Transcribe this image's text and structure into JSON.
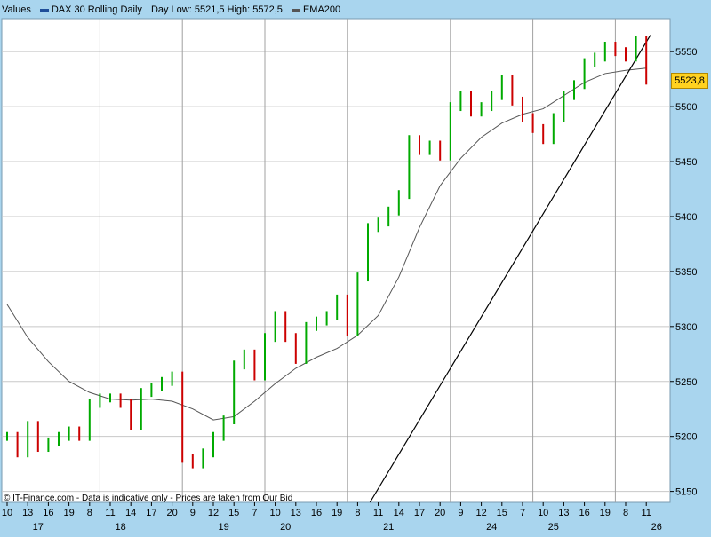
{
  "legend": {
    "label": "Values",
    "instrument": "DAX 30  Rolling Daily",
    "day_range": "Day Low: 5521,5  High: 5572,5",
    "indicator": "EMA200",
    "instrument_color": "#1f4e99",
    "indicator_color": "#555555"
  },
  "footer": {
    "copyright": "© IT-Finance.com  - Data is indicative only - Prices are taken from Our Bid"
  },
  "last_price": "5523,8",
  "colors": {
    "plot_background": "#ffffff",
    "outer_background": "#a9d5ee",
    "up_bar": "#00aa00",
    "down_bar": "#cc0000",
    "ema": "#555555",
    "trendline": "#000000",
    "grid": "#c8c8c8",
    "last_price_box": "#ffd21f"
  },
  "chart_data": {
    "type": "line",
    "instrument": "DAX 30",
    "indicator": "EMA200",
    "ylim": [
      5140,
      5580
    ],
    "y_ticks": [
      5150,
      5200,
      5250,
      5300,
      5350,
      5400,
      5450,
      5500,
      5550
    ],
    "y_tick_labels": [
      "5150",
      "5200",
      "5250",
      "5300",
      "5350",
      "5400",
      "5450",
      "5500",
      "5550"
    ],
    "x_hour_labels": [
      "10",
      "13",
      "16",
      "19",
      "8",
      "11",
      "14",
      "17",
      "20",
      "9",
      "12",
      "15",
      "7",
      "10",
      "13",
      "16",
      "19",
      "8",
      "11",
      "14",
      "17",
      "20",
      "9",
      "12",
      "15",
      "7",
      "10",
      "13",
      "16",
      "19",
      "8",
      "11"
    ],
    "x_day_labels": [
      {
        "label": "17",
        "after_hour_index": 0
      },
      {
        "label": "18",
        "after_hour_index": 4
      },
      {
        "label": "19",
        "after_hour_index": 9
      },
      {
        "label": "20",
        "after_hour_index": 12
      },
      {
        "label": "21",
        "after_hour_index": 17
      },
      {
        "label": "24",
        "after_hour_index": 22
      },
      {
        "label": "25",
        "after_hour_index": 25
      },
      {
        "label": "26",
        "after_hour_index": 30
      }
    ],
    "day_separators_after_hour_index": [
      4,
      8,
      12,
      16,
      21,
      25,
      29
    ],
    "price_series": {
      "name": "DAX 30",
      "x": [
        0,
        0.5,
        1,
        1.5,
        2,
        2.5,
        3,
        3.5,
        4,
        4.5,
        5,
        5.5,
        6,
        6.5,
        7,
        7.5,
        8,
        8.5,
        9,
        9.5,
        10,
        10.5,
        11,
        11.5,
        12,
        12.5,
        13,
        13.5,
        14,
        14.5,
        15,
        15.5,
        16,
        16.5,
        17,
        17.5,
        18,
        18.5,
        19,
        19.5,
        20,
        20.5,
        21,
        21.5,
        22,
        22.5,
        23,
        23.5,
        24,
        24.5,
        25,
        25.5,
        26,
        26.5,
        27,
        27.5,
        28,
        28.5,
        29,
        29.5,
        30,
        30.5,
        31
      ],
      "y": [
        5200,
        5185,
        5210,
        5190,
        5195,
        5200,
        5205,
        5200,
        5230,
        5235,
        5235,
        5230,
        5210,
        5240,
        5245,
        5250,
        5255,
        5180,
        5175,
        5185,
        5200,
        5215,
        5265,
        5275,
        5255,
        5290,
        5310,
        5290,
        5270,
        5300,
        5305,
        5310,
        5325,
        5295,
        5345,
        5390,
        5395,
        5405,
        5420,
        5470,
        5460,
        5465,
        5455,
        5500,
        5510,
        5495,
        5500,
        5510,
        5525,
        5505,
        5490,
        5480,
        5470,
        5490,
        5510,
        5520,
        5540,
        5545,
        5555,
        5550,
        5545,
        5560,
        5524
      ]
    },
    "ema_series": {
      "name": "EMA200",
      "x": [
        0,
        1,
        2,
        3,
        4,
        5,
        6,
        7,
        8,
        9,
        10,
        11,
        12,
        13,
        14,
        15,
        16,
        17,
        18,
        19,
        20,
        21,
        22,
        23,
        24,
        25,
        26,
        27,
        28,
        29,
        30,
        31
      ],
      "y": [
        5320,
        5290,
        5268,
        5250,
        5240,
        5234,
        5233,
        5234,
        5232,
        5225,
        5215,
        5218,
        5232,
        5248,
        5262,
        5272,
        5280,
        5292,
        5310,
        5345,
        5390,
        5428,
        5453,
        5472,
        5485,
        5493,
        5498,
        5510,
        5522,
        5530,
        5533,
        5535
      ]
    },
    "trendline": {
      "name": "",
      "x": [
        17.6,
        31.2
      ],
      "y": [
        5140,
        5565
      ]
    }
  }
}
